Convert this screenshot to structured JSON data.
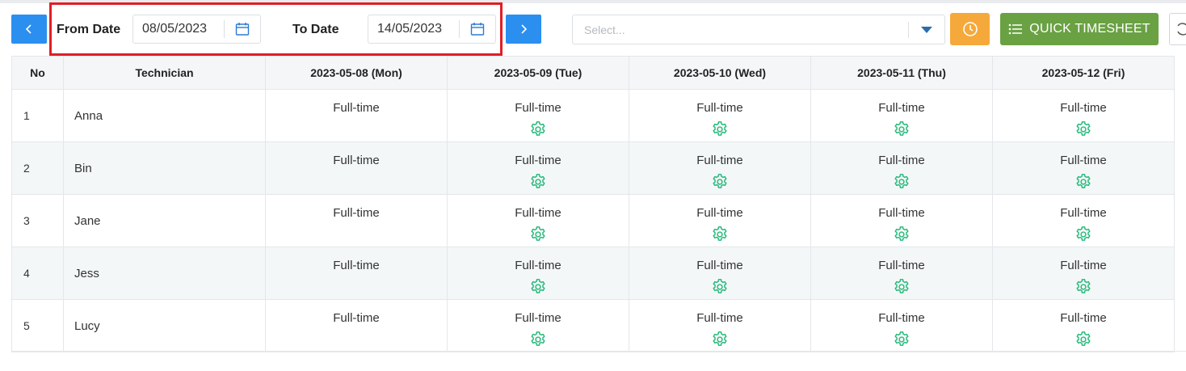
{
  "toolbar": {
    "from_label": "From Date",
    "from_value": "08/05/2023",
    "to_label": "To Date",
    "to_value": "14/05/2023",
    "select_placeholder": "Select...",
    "quick_timesheet_label": "QUICK TIMESHEET"
  },
  "colors": {
    "primary": "#2b8ff0",
    "warning": "#f5a93a",
    "success": "#6aa143",
    "gear": "#26b97a",
    "highlight": "#e01e25"
  },
  "icons": {
    "prev": "chevron-left-icon",
    "next": "chevron-right-icon",
    "calendar": "calendar-icon",
    "caret": "caret-down-icon",
    "clock": "clock-icon",
    "list": "list-icon",
    "refresh": "refresh-icon",
    "gear": "gear-icon"
  },
  "table": {
    "headers": [
      "No",
      "Technician",
      "2023-05-08 (Mon)",
      "2023-05-09 (Tue)",
      "2023-05-10 (Wed)",
      "2023-05-11 (Thu)",
      "2023-05-12 (Fri)"
    ],
    "rows": [
      {
        "no": "1",
        "technician": "Anna",
        "days": [
          "Full-time",
          "Full-time",
          "Full-time",
          "Full-time",
          "Full-time"
        ]
      },
      {
        "no": "2",
        "technician": "Bin",
        "days": [
          "Full-time",
          "Full-time",
          "Full-time",
          "Full-time",
          "Full-time"
        ]
      },
      {
        "no": "3",
        "technician": "Jane",
        "days": [
          "Full-time",
          "Full-time",
          "Full-time",
          "Full-time",
          "Full-time"
        ]
      },
      {
        "no": "4",
        "technician": "Jess",
        "days": [
          "Full-time",
          "Full-time",
          "Full-time",
          "Full-time",
          "Full-time"
        ]
      },
      {
        "no": "5",
        "technician": "Lucy",
        "days": [
          "Full-time",
          "Full-time",
          "Full-time",
          "Full-time",
          "Full-time"
        ]
      }
    ]
  }
}
